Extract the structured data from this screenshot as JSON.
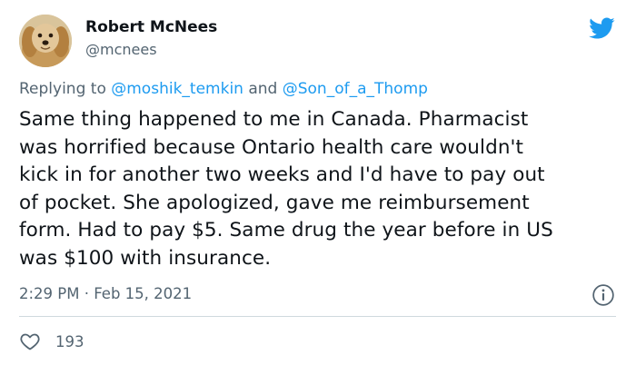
{
  "tweet": {
    "author": {
      "display_name": "Robert McNees",
      "handle": "@mcnees",
      "avatar_icon": "dog-avatar"
    },
    "brand_icon": "twitter-bird-icon",
    "brand_color": "#1d9bf0",
    "replying_to": {
      "prefix": "Replying to ",
      "mention_1": "@moshik_temkin",
      "joiner": " and ",
      "mention_2": "@Son_of_a_Thomp"
    },
    "text": "Same thing happened to me in Canada. Pharmacist\nwas horrified because Ontario health care wouldn't\nkick in for another two weeks and I'd have to pay out\nof pocket. She apologized, gave me reimbursement\nform. Had to pay $5. Same drug the year before in US\nwas $100 with insurance.",
    "timestamp": "2:29 PM · Feb 15, 2021",
    "like_count": "193"
  }
}
